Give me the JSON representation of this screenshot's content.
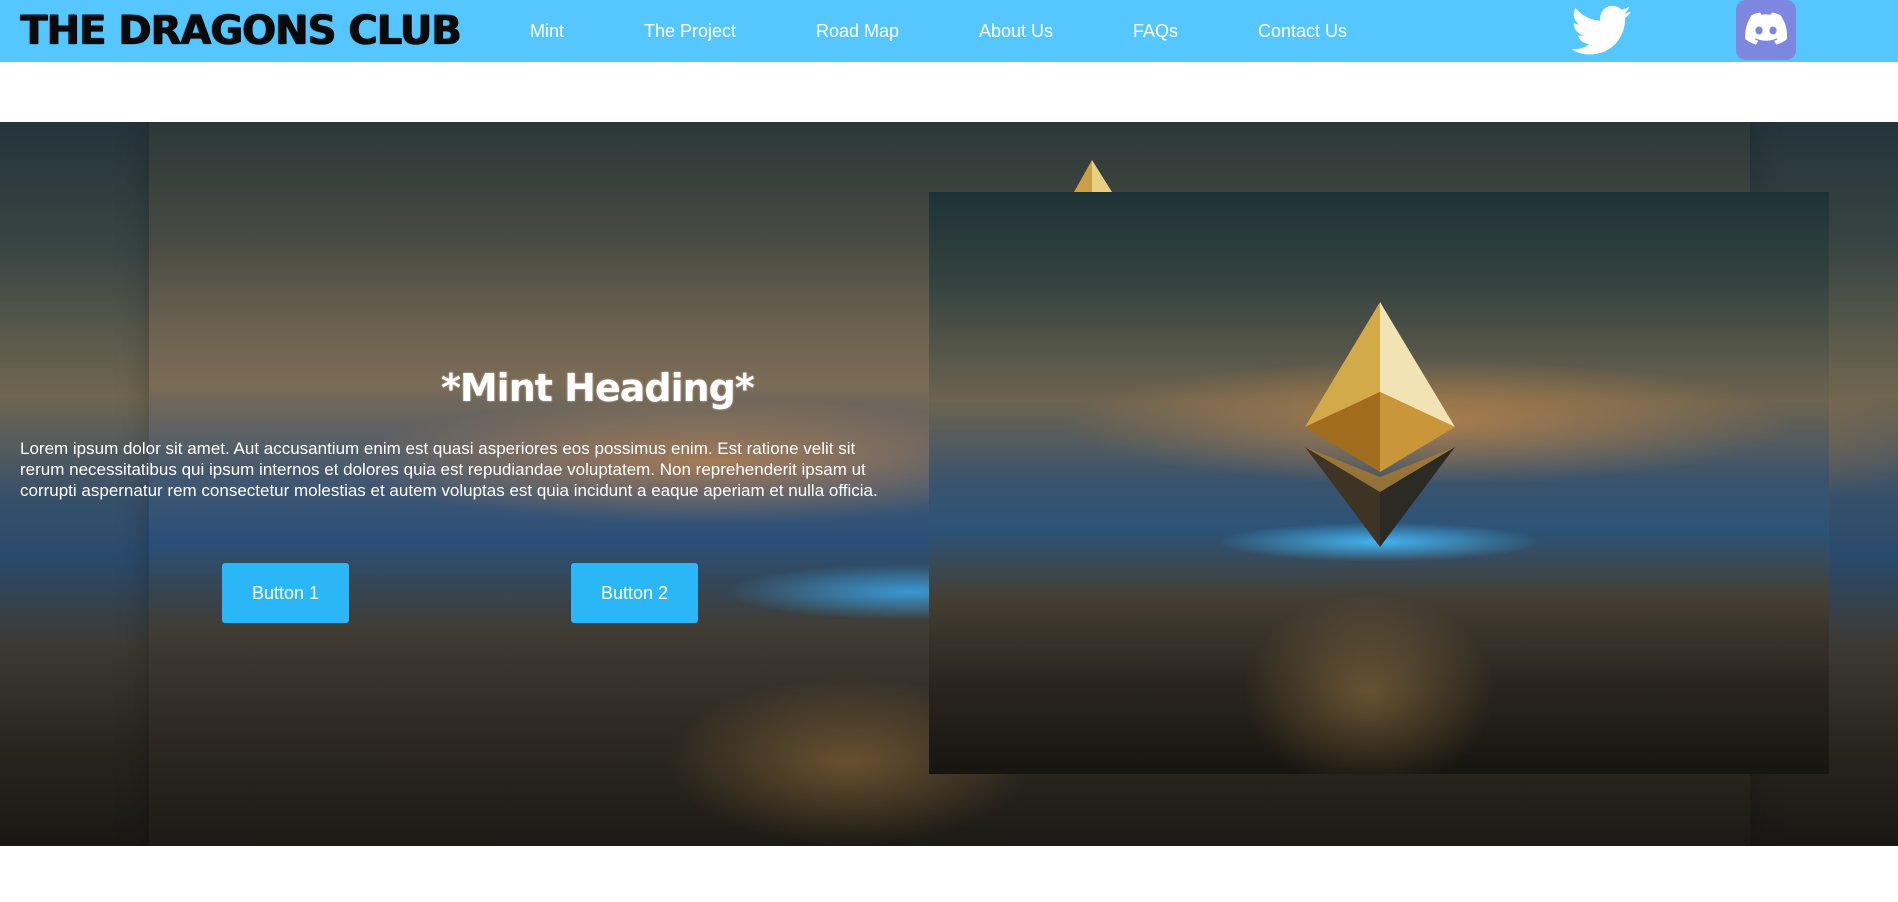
{
  "header": {
    "brand": "The Dragons Club",
    "nav": [
      {
        "label": "Mint"
      },
      {
        "label": "The Project"
      },
      {
        "label": "Road Map"
      },
      {
        "label": "About Us"
      },
      {
        "label": "FAQs"
      },
      {
        "label": "Contact Us"
      }
    ],
    "social": [
      {
        "icon": "twitter-icon"
      },
      {
        "icon": "discord-icon"
      }
    ]
  },
  "hero": {
    "heading": "*Mint Heading*",
    "paragraph": "Lorem ipsum dolor sit amet. Aut accusantium enim est quasi asperiores eos possimus enim. Est ratione velit sit rerum necessitatibus qui ipsum internos et dolores quia est repudiandae voluptatem. Non reprehenderit ipsam ut corrupti aspernatur rem consectetur molestias et autem voluptas est quia incidunt a eaque aperiam et nulla officia.",
    "button1": "Button 1",
    "button2": "Button 2"
  },
  "colors": {
    "navbar": "#56c6fe",
    "button": "#2ab6f7",
    "discord": "#7d87e0"
  }
}
